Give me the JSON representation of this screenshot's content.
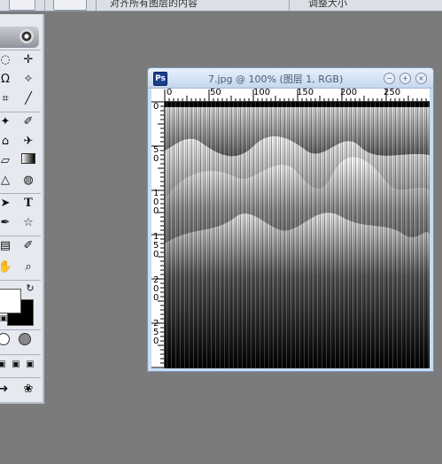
{
  "options_bar": {
    "label_left": "对齐所有图层的内容",
    "label_right": "调整大小"
  },
  "tools_palette": {
    "tools": [
      {
        "name": "marquee-icon",
        "glyph": "◌"
      },
      {
        "name": "move-icon",
        "glyph": "✛"
      },
      {
        "name": "lasso-icon",
        "glyph": "Ω"
      },
      {
        "name": "magic-wand-icon",
        "glyph": "✧"
      },
      {
        "name": "crop-icon",
        "glyph": "⌗"
      },
      {
        "name": "slice-icon",
        "glyph": "╱"
      },
      {
        "name": "healing-brush-icon",
        "glyph": "✦"
      },
      {
        "name": "brush-icon",
        "glyph": "✐"
      },
      {
        "name": "stamp-icon",
        "glyph": "⌂"
      },
      {
        "name": "history-brush-icon",
        "glyph": "✈"
      },
      {
        "name": "eraser-icon",
        "glyph": "▱"
      },
      {
        "name": "gradient-icon",
        "glyph": "■"
      },
      {
        "name": "blur-icon",
        "glyph": "△"
      },
      {
        "name": "dodge-icon",
        "glyph": "◍"
      },
      {
        "name": "path-select-icon",
        "glyph": "➤"
      },
      {
        "name": "type-icon",
        "glyph": "T"
      },
      {
        "name": "pen-icon",
        "glyph": "✒"
      },
      {
        "name": "custom-shape-icon",
        "glyph": "☆"
      },
      {
        "name": "notes-icon",
        "glyph": "▤"
      },
      {
        "name": "eyedropper-icon",
        "glyph": "✐"
      },
      {
        "name": "hand-icon",
        "glyph": "✋"
      },
      {
        "name": "zoom-icon",
        "glyph": "⌕"
      }
    ]
  },
  "document": {
    "title": "7.jpg @ 100% (图层 1, RGB)",
    "ruler_top_labels": [
      "0",
      "50",
      "100",
      "150",
      "200",
      "250"
    ],
    "ruler_left_labels": [
      "0",
      "5 0",
      "1 0 0",
      "1 5 0",
      "2 0 0",
      "2 5 0"
    ]
  },
  "colors": {
    "foreground": "#ffffff",
    "background": "#000000",
    "workspace": "#7b7b7b"
  }
}
